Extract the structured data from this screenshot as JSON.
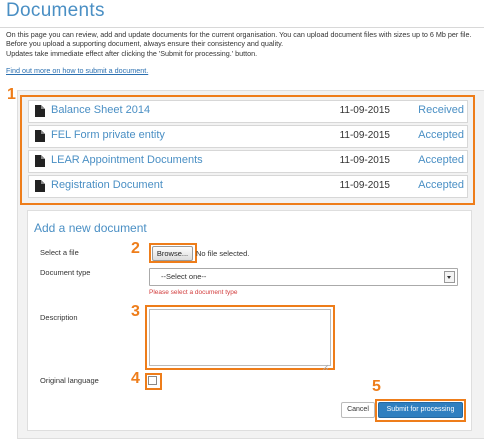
{
  "page": {
    "title": "Documents",
    "intro_lines": [
      "On this page you can review, add and update documents for the current organisation. You can upload document files with sizes up to 6 Mb per file.",
      "Before you upload a supporting document, always ensure their consistency and quality.",
      "Updates take immediate effect after clicking the 'Submit for processing.' button."
    ],
    "help_link": "Find out more on how to submit a document."
  },
  "annotations": [
    "1",
    "2",
    "3",
    "4",
    "5"
  ],
  "documents": [
    {
      "name": "Balance Sheet 2014",
      "date": "11-09-2015",
      "status": "Received"
    },
    {
      "name": "FEL Form private entity",
      "date": "11-09-2015",
      "status": "Accepted"
    },
    {
      "name": "LEAR Appointment Documents",
      "date": "11-09-2015",
      "status": "Accepted"
    },
    {
      "name": "Registration Document",
      "date": "11-09-2015",
      "status": "Accepted"
    }
  ],
  "form": {
    "title": "Add a new document",
    "file_label": "Select a file",
    "browse_label": "Browse...",
    "no_file_text": "No file selected.",
    "doctype_label": "Document type",
    "doctype_value": "--Select one--",
    "doctype_error": "Please select a document type",
    "description_label": "Description",
    "description_value": "",
    "language_label": "Original language",
    "language_checked": false,
    "cancel_label": "Cancel",
    "submit_label": "Submit for processing"
  },
  "icons": {
    "document": "document-icon",
    "dropdown": "chevron-down-icon"
  },
  "colors": {
    "accent": "#4a8fc4",
    "highlight": "#ee7d1a",
    "primary_button": "#2f7fc0",
    "error": "#d23c3c"
  }
}
